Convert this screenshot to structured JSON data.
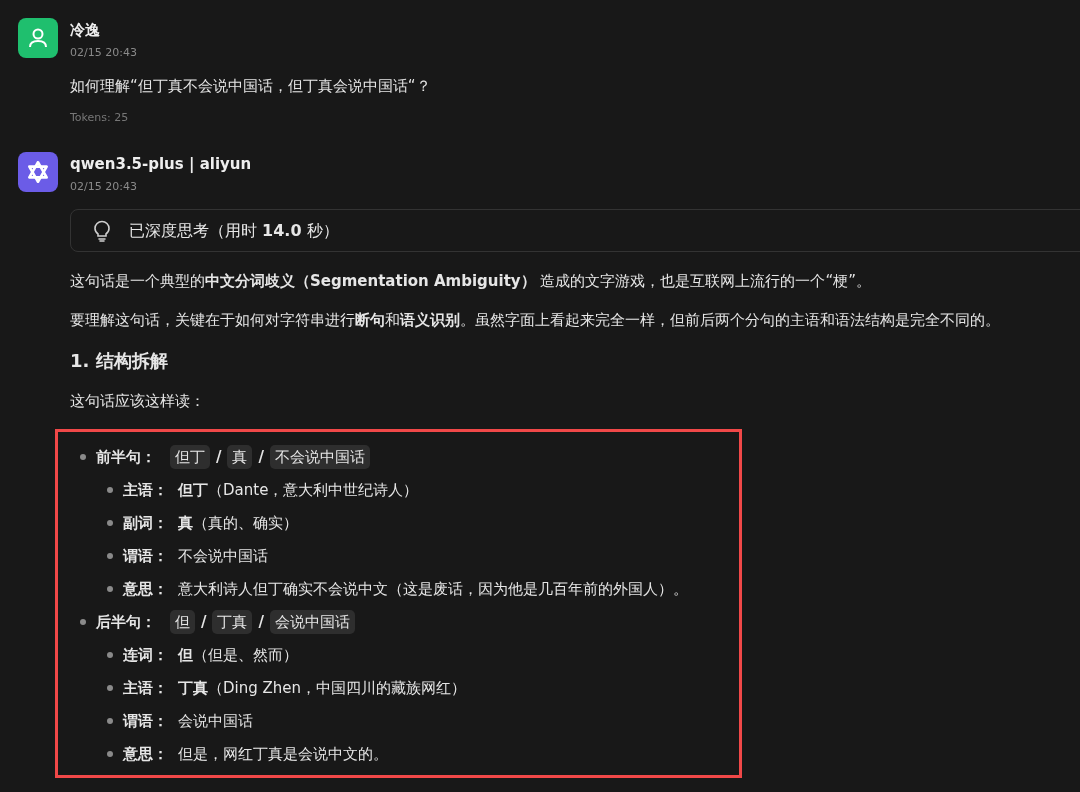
{
  "messages": [
    {
      "kind": "user",
      "name": "冷逸",
      "time": "02/15 20:43",
      "text": "如何理解“但丁真不会说中国话，但丁真会说中国话“？",
      "tokens": "Tokens: 25"
    },
    {
      "kind": "assistant",
      "name": "qwen3.5-plus | aliyun",
      "time": "02/15 20:43",
      "thinking": "已深度思考（用时 **14.0** 秒）",
      "blocks": [
        {
          "kind": "paragraph",
          "text": "这句话是一个典型的**中文分词歧义（Segmentation Ambiguity）** 造成的文字游戏，也是互联网上流行的一个“梗”。"
        },
        {
          "kind": "paragraph",
          "text": "要理解这句话，关键在于如何对字符串进行**断句**和**语义识别**。虽然字面上看起来完全一样，但前后两个分句的主语和语法结构是完全不同的。"
        },
        {
          "kind": "heading",
          "text": "1. 结构拆解"
        },
        {
          "kind": "paragraph",
          "text": "这句话应该这样读："
        },
        {
          "kind": "list",
          "highlighted": true,
          "items": [
            {
              "label": "前半句：",
              "segments": [
                {
                  "kind": "chip",
                  "text": "但丁"
                },
                {
                  "kind": "sep",
                  "text": "/"
                },
                {
                  "kind": "chip",
                  "text": "真"
                },
                {
                  "kind": "sep",
                  "text": "/"
                },
                {
                  "kind": "chip",
                  "text": "不会说中国话"
                }
              ],
              "children": [
                {
                  "label": "主语：",
                  "text": "**但丁**（Dante，意大利中世纪诗人）"
                },
                {
                  "label": "副词：",
                  "text": "**真**（真的、确实）"
                },
                {
                  "label": "谓语：",
                  "text": "不会说中国话"
                },
                {
                  "label": "意思：",
                  "text": "意大利诗人但丁确实不会说中文（这是废话，因为他是几百年前的外国人）。"
                }
              ]
            },
            {
              "label": "后半句：",
              "segments": [
                {
                  "kind": "chip",
                  "text": "但"
                },
                {
                  "kind": "sep",
                  "text": "/"
                },
                {
                  "kind": "chip",
                  "text": "丁真"
                },
                {
                  "kind": "sep",
                  "text": "/"
                },
                {
                  "kind": "chip",
                  "text": "会说中国话"
                }
              ],
              "children": [
                {
                  "label": "连词：",
                  "text": "**但**（但是、然而）"
                },
                {
                  "label": "主语：",
                  "text": "**丁真**（Ding Zhen，中国四川的藏族网红）"
                },
                {
                  "label": "谓语：",
                  "text": "会说中国话"
                },
                {
                  "label": "意思：",
                  "text": "但是，网红丁真是会说中文的。"
                }
              ]
            }
          ]
        }
      ]
    }
  ]
}
